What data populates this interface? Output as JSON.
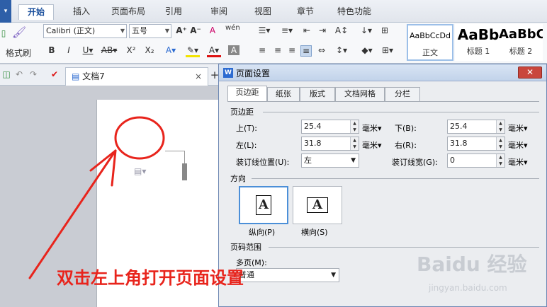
{
  "tabs": [
    "开始",
    "插入",
    "页面布局",
    "引用",
    "审阅",
    "视图",
    "章节",
    "特色功能"
  ],
  "ribbon": {
    "format_painter": "格式刷",
    "font_name": "Calibri (正文)",
    "font_size": "五号",
    "styles": [
      {
        "sample": "AaBbCcDd",
        "name": "正文"
      },
      {
        "sample": "AaBb",
        "name": "标题 1"
      },
      {
        "sample": "AaBbC",
        "name": "标题 2"
      }
    ]
  },
  "document_tab": "文档7",
  "dialog": {
    "title": "页面设置",
    "tabs": [
      "页边距",
      "纸张",
      "版式",
      "文档网格",
      "分栏"
    ],
    "margins_section": "页边距",
    "top_label": "上(T):",
    "top_value": "25.4",
    "bottom_label": "下(B):",
    "bottom_value": "25.4",
    "left_label": "左(L):",
    "left_value": "31.8",
    "right_label": "右(R):",
    "right_value": "31.8",
    "gutter_pos_label": "装订线位置(U):",
    "gutter_pos_value": "左",
    "gutter_width_label": "装订线宽(G):",
    "gutter_width_value": "0",
    "unit": "毫米",
    "orientation_section": "方向",
    "portrait_label": "纵向(P)",
    "landscape_label": "横向(S)",
    "page_range_section": "页码范围",
    "multiple_pages_label": "多页(M):",
    "multiple_pages_value": "普通"
  },
  "annotation": "双击左上角打开页面设置",
  "watermark": "Baidu 经验",
  "watermark_url": "jingyan.baidu.com",
  "colors": {
    "accent": "#1a4f9c",
    "annotation": "#e8241c",
    "close": "#c9463d"
  }
}
